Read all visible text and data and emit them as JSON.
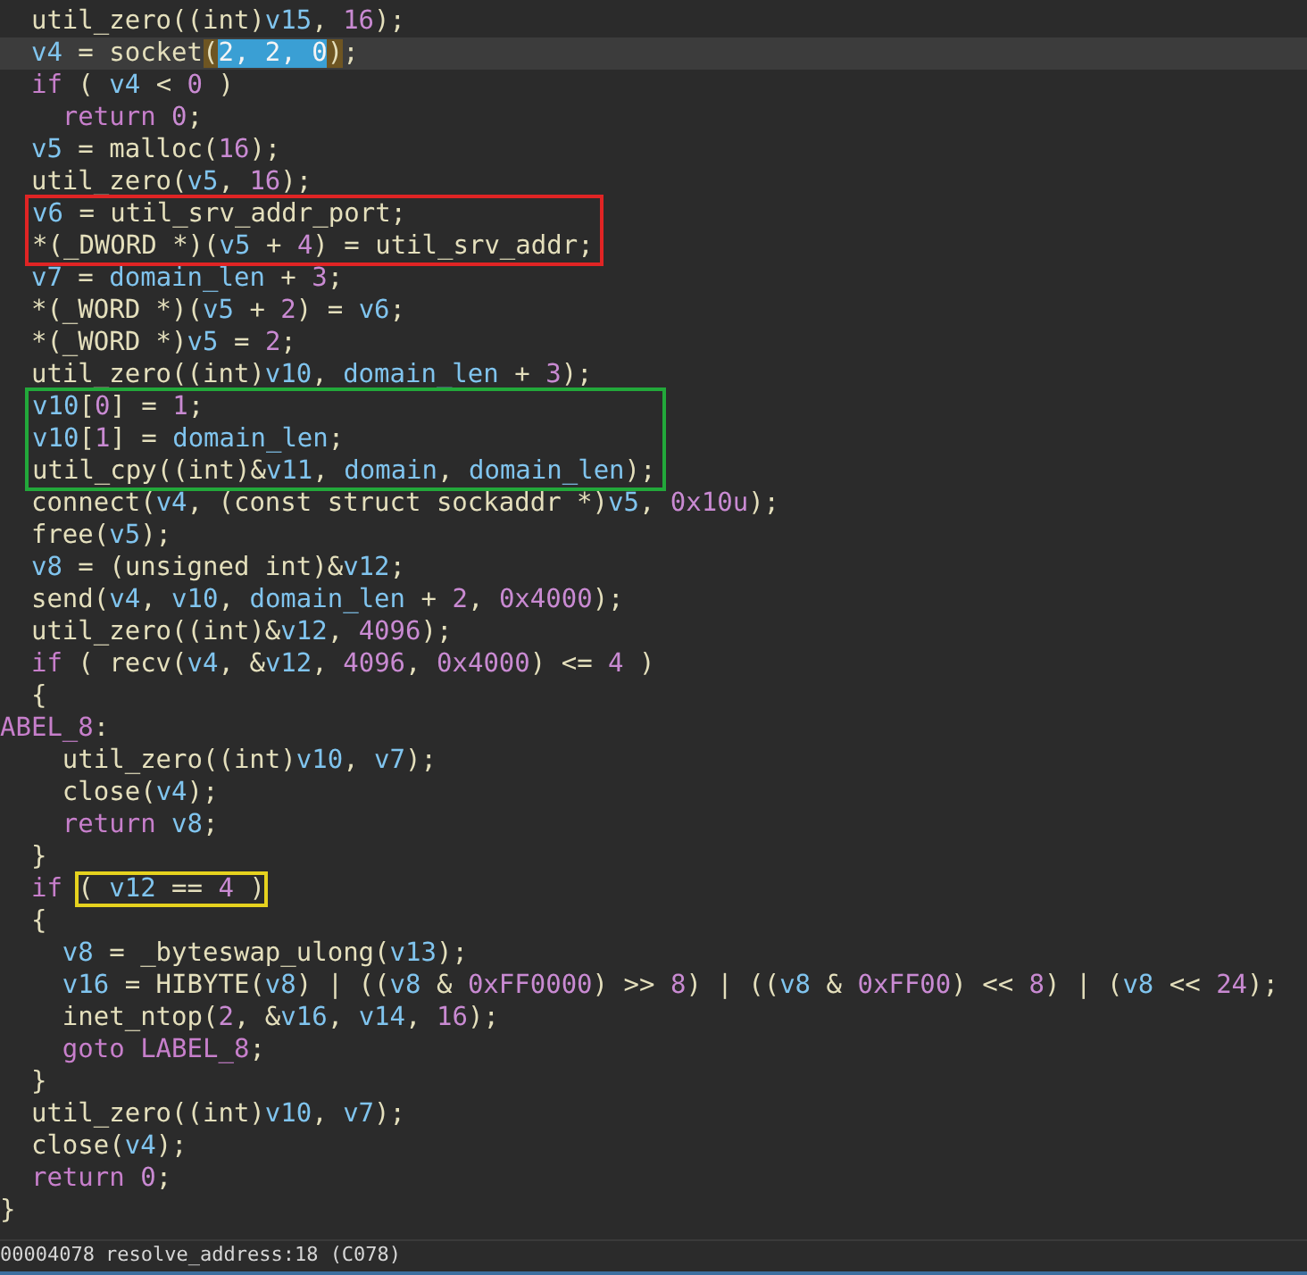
{
  "code": [
    {
      "kind": "line",
      "current": false,
      "segments": [
        {
          "kind": "p",
          "text": "  util_zero((int)"
        },
        {
          "kind": "v",
          "text": "v15"
        },
        {
          "kind": "p",
          "text": ", "
        },
        {
          "kind": "n",
          "text": "16"
        },
        {
          "kind": "p",
          "text": ");"
        }
      ]
    },
    {
      "kind": "line",
      "current": true,
      "segments": [
        {
          "kind": "v",
          "text": "  v4"
        },
        {
          "kind": "p",
          "text": " = socket"
        },
        {
          "kind": "brace",
          "text": "("
        },
        {
          "kind": "sel",
          "text": "2, 2, 0"
        },
        {
          "kind": "brace",
          "text": ")"
        },
        {
          "kind": "p",
          "text": ";"
        }
      ]
    },
    {
      "kind": "line",
      "current": false,
      "segments": [
        {
          "kind": "k",
          "text": "  if"
        },
        {
          "kind": "p",
          "text": " ( "
        },
        {
          "kind": "v",
          "text": "v4"
        },
        {
          "kind": "p",
          "text": " < "
        },
        {
          "kind": "n",
          "text": "0"
        },
        {
          "kind": "p",
          "text": " )"
        }
      ]
    },
    {
      "kind": "line",
      "current": false,
      "segments": [
        {
          "kind": "k",
          "text": "    return "
        },
        {
          "kind": "n",
          "text": "0"
        },
        {
          "kind": "p",
          "text": ";"
        }
      ]
    },
    {
      "kind": "line",
      "current": false,
      "segments": [
        {
          "kind": "v",
          "text": "  v5"
        },
        {
          "kind": "p",
          "text": " = malloc("
        },
        {
          "kind": "n",
          "text": "16"
        },
        {
          "kind": "p",
          "text": ");"
        }
      ]
    },
    {
      "kind": "line",
      "current": false,
      "segments": [
        {
          "kind": "p",
          "text": "  util_zero("
        },
        {
          "kind": "v",
          "text": "v5"
        },
        {
          "kind": "p",
          "text": ", "
        },
        {
          "kind": "n",
          "text": "16"
        },
        {
          "kind": "p",
          "text": ");"
        }
      ]
    },
    {
      "kind": "box",
      "color": "#e02424",
      "lines": [
        {
          "current": false,
          "segments": [
            {
              "kind": "v",
              "text": "v6"
            },
            {
              "kind": "p",
              "text": " = util_srv_addr_port;"
            }
          ]
        },
        {
          "current": false,
          "segments": [
            {
              "kind": "p",
              "text": "*(_DWORD *)("
            },
            {
              "kind": "v",
              "text": "v5"
            },
            {
              "kind": "p",
              "text": " + "
            },
            {
              "kind": "n",
              "text": "4"
            },
            {
              "kind": "p",
              "text": ") = util_srv_addr;"
            }
          ]
        }
      ]
    },
    {
      "kind": "line",
      "current": false,
      "segments": [
        {
          "kind": "v",
          "text": "  v7"
        },
        {
          "kind": "p",
          "text": " = "
        },
        {
          "kind": "v",
          "text": "domain_len"
        },
        {
          "kind": "p",
          "text": " + "
        },
        {
          "kind": "n",
          "text": "3"
        },
        {
          "kind": "p",
          "text": ";"
        }
      ]
    },
    {
      "kind": "line",
      "current": false,
      "segments": [
        {
          "kind": "p",
          "text": "  *(_WORD *)("
        },
        {
          "kind": "v",
          "text": "v5"
        },
        {
          "kind": "p",
          "text": " + "
        },
        {
          "kind": "n",
          "text": "2"
        },
        {
          "kind": "p",
          "text": ") = "
        },
        {
          "kind": "v",
          "text": "v6"
        },
        {
          "kind": "p",
          "text": ";"
        }
      ]
    },
    {
      "kind": "line",
      "current": false,
      "segments": [
        {
          "kind": "p",
          "text": "  *(_WORD *)"
        },
        {
          "kind": "v",
          "text": "v5"
        },
        {
          "kind": "p",
          "text": " = "
        },
        {
          "kind": "n",
          "text": "2"
        },
        {
          "kind": "p",
          "text": ";"
        }
      ]
    },
    {
      "kind": "line",
      "current": false,
      "segments": [
        {
          "kind": "p",
          "text": "  util_zero((int)"
        },
        {
          "kind": "v",
          "text": "v10"
        },
        {
          "kind": "p",
          "text": ", "
        },
        {
          "kind": "v",
          "text": "domain_len"
        },
        {
          "kind": "p",
          "text": " + "
        },
        {
          "kind": "n",
          "text": "3"
        },
        {
          "kind": "p",
          "text": ");"
        }
      ]
    },
    {
      "kind": "box",
      "color": "#22a83a",
      "lines": [
        {
          "current": false,
          "segments": [
            {
              "kind": "v",
              "text": "v10"
            },
            {
              "kind": "p",
              "text": "["
            },
            {
              "kind": "n",
              "text": "0"
            },
            {
              "kind": "p",
              "text": "] = "
            },
            {
              "kind": "n",
              "text": "1"
            },
            {
              "kind": "p",
              "text": ";"
            }
          ]
        },
        {
          "current": false,
          "segments": [
            {
              "kind": "v",
              "text": "v10"
            },
            {
              "kind": "p",
              "text": "["
            },
            {
              "kind": "n",
              "text": "1"
            },
            {
              "kind": "p",
              "text": "] = "
            },
            {
              "kind": "v",
              "text": "domain_len"
            },
            {
              "kind": "p",
              "text": ";"
            }
          ]
        },
        {
          "current": false,
          "segments": [
            {
              "kind": "p",
              "text": "util_cpy((int)&"
            },
            {
              "kind": "v",
              "text": "v11"
            },
            {
              "kind": "p",
              "text": ", "
            },
            {
              "kind": "v",
              "text": "domain"
            },
            {
              "kind": "p",
              "text": ", "
            },
            {
              "kind": "v",
              "text": "domain_len"
            },
            {
              "kind": "p",
              "text": ");"
            }
          ]
        }
      ]
    },
    {
      "kind": "line",
      "current": false,
      "segments": [
        {
          "kind": "p",
          "text": "  connect("
        },
        {
          "kind": "v",
          "text": "v4"
        },
        {
          "kind": "p",
          "text": ", (const struct sockaddr *)"
        },
        {
          "kind": "v",
          "text": "v5"
        },
        {
          "kind": "p",
          "text": ", "
        },
        {
          "kind": "n",
          "text": "0x10u"
        },
        {
          "kind": "p",
          "text": ");"
        }
      ]
    },
    {
      "kind": "line",
      "current": false,
      "segments": [
        {
          "kind": "p",
          "text": "  free("
        },
        {
          "kind": "v",
          "text": "v5"
        },
        {
          "kind": "p",
          "text": ");"
        }
      ]
    },
    {
      "kind": "line",
      "current": false,
      "segments": [
        {
          "kind": "v",
          "text": "  v8"
        },
        {
          "kind": "p",
          "text": " = (unsigned int)&"
        },
        {
          "kind": "v",
          "text": "v12"
        },
        {
          "kind": "p",
          "text": ";"
        }
      ]
    },
    {
      "kind": "line",
      "current": false,
      "segments": [
        {
          "kind": "p",
          "text": "  send("
        },
        {
          "kind": "v",
          "text": "v4"
        },
        {
          "kind": "p",
          "text": ", "
        },
        {
          "kind": "v",
          "text": "v10"
        },
        {
          "kind": "p",
          "text": ", "
        },
        {
          "kind": "v",
          "text": "domain_len"
        },
        {
          "kind": "p",
          "text": " + "
        },
        {
          "kind": "n",
          "text": "2"
        },
        {
          "kind": "p",
          "text": ", "
        },
        {
          "kind": "n",
          "text": "0x4000"
        },
        {
          "kind": "p",
          "text": ");"
        }
      ]
    },
    {
      "kind": "line",
      "current": false,
      "segments": [
        {
          "kind": "p",
          "text": "  util_zero((int)&"
        },
        {
          "kind": "v",
          "text": "v12"
        },
        {
          "kind": "p",
          "text": ", "
        },
        {
          "kind": "n",
          "text": "4096"
        },
        {
          "kind": "p",
          "text": ");"
        }
      ]
    },
    {
      "kind": "line",
      "current": false,
      "segments": [
        {
          "kind": "k",
          "text": "  if"
        },
        {
          "kind": "p",
          "text": " ( recv("
        },
        {
          "kind": "v",
          "text": "v4"
        },
        {
          "kind": "p",
          "text": ", &"
        },
        {
          "kind": "v",
          "text": "v12"
        },
        {
          "kind": "p",
          "text": ", "
        },
        {
          "kind": "n",
          "text": "4096"
        },
        {
          "kind": "p",
          "text": ", "
        },
        {
          "kind": "n",
          "text": "0x4000"
        },
        {
          "kind": "p",
          "text": ") <= "
        },
        {
          "kind": "n",
          "text": "4"
        },
        {
          "kind": "p",
          "text": " )"
        }
      ]
    },
    {
      "kind": "line",
      "current": false,
      "segments": [
        {
          "kind": "p",
          "text": "  {"
        }
      ]
    },
    {
      "kind": "line",
      "current": false,
      "segments": [
        {
          "kind": "l",
          "text": "ABEL_8"
        },
        {
          "kind": "p",
          "text": ":"
        }
      ]
    },
    {
      "kind": "line",
      "current": false,
      "segments": [
        {
          "kind": "p",
          "text": "    util_zero((int)"
        },
        {
          "kind": "v",
          "text": "v10"
        },
        {
          "kind": "p",
          "text": ", "
        },
        {
          "kind": "v",
          "text": "v7"
        },
        {
          "kind": "p",
          "text": ");"
        }
      ]
    },
    {
      "kind": "line",
      "current": false,
      "segments": [
        {
          "kind": "p",
          "text": "    close("
        },
        {
          "kind": "v",
          "text": "v4"
        },
        {
          "kind": "p",
          "text": ");"
        }
      ]
    },
    {
      "kind": "line",
      "current": false,
      "segments": [
        {
          "kind": "k",
          "text": "    return "
        },
        {
          "kind": "v",
          "text": "v8"
        },
        {
          "kind": "p",
          "text": ";"
        }
      ]
    },
    {
      "kind": "line",
      "current": false,
      "segments": [
        {
          "kind": "p",
          "text": "  }"
        }
      ]
    },
    {
      "kind": "line",
      "current": false,
      "segments": [
        {
          "kind": "k",
          "text": "  if "
        },
        {
          "kind": "box",
          "color": "#e6d21e",
          "segments": [
            {
              "kind": "p",
              "text": "( "
            },
            {
              "kind": "v",
              "text": "v12"
            },
            {
              "kind": "p",
              "text": " == "
            },
            {
              "kind": "n",
              "text": "4"
            },
            {
              "kind": "p",
              "text": " )"
            }
          ]
        }
      ]
    },
    {
      "kind": "line",
      "current": false,
      "segments": [
        {
          "kind": "p",
          "text": "  {"
        }
      ]
    },
    {
      "kind": "line",
      "current": false,
      "segments": [
        {
          "kind": "v",
          "text": "    v8"
        },
        {
          "kind": "p",
          "text": " = _byteswap_ulong("
        },
        {
          "kind": "v",
          "text": "v13"
        },
        {
          "kind": "p",
          "text": ");"
        }
      ]
    },
    {
      "kind": "line",
      "current": false,
      "segments": [
        {
          "kind": "v",
          "text": "    v16"
        },
        {
          "kind": "p",
          "text": " = HIBYTE("
        },
        {
          "kind": "v",
          "text": "v8"
        },
        {
          "kind": "p",
          "text": ") | (("
        },
        {
          "kind": "v",
          "text": "v8"
        },
        {
          "kind": "p",
          "text": " & "
        },
        {
          "kind": "n",
          "text": "0xFF0000"
        },
        {
          "kind": "p",
          "text": ") >> "
        },
        {
          "kind": "n",
          "text": "8"
        },
        {
          "kind": "p",
          "text": ") | (("
        },
        {
          "kind": "v",
          "text": "v8"
        },
        {
          "kind": "p",
          "text": " & "
        },
        {
          "kind": "n",
          "text": "0xFF00"
        },
        {
          "kind": "p",
          "text": ") << "
        },
        {
          "kind": "n",
          "text": "8"
        },
        {
          "kind": "p",
          "text": ") | ("
        },
        {
          "kind": "v",
          "text": "v8"
        },
        {
          "kind": "p",
          "text": " << "
        },
        {
          "kind": "n",
          "text": "24"
        },
        {
          "kind": "p",
          "text": ");"
        }
      ]
    },
    {
      "kind": "line",
      "current": false,
      "segments": [
        {
          "kind": "p",
          "text": "    inet_ntop("
        },
        {
          "kind": "n",
          "text": "2"
        },
        {
          "kind": "p",
          "text": ", &"
        },
        {
          "kind": "v",
          "text": "v16"
        },
        {
          "kind": "p",
          "text": ", "
        },
        {
          "kind": "v",
          "text": "v14"
        },
        {
          "kind": "p",
          "text": ", "
        },
        {
          "kind": "n",
          "text": "16"
        },
        {
          "kind": "p",
          "text": ");"
        }
      ]
    },
    {
      "kind": "line",
      "current": false,
      "segments": [
        {
          "kind": "k",
          "text": "    goto "
        },
        {
          "kind": "l",
          "text": "LABEL_8"
        },
        {
          "kind": "p",
          "text": ";"
        }
      ]
    },
    {
      "kind": "line",
      "current": false,
      "segments": [
        {
          "kind": "p",
          "text": "  }"
        }
      ]
    },
    {
      "kind": "line",
      "current": false,
      "segments": [
        {
          "kind": "p",
          "text": "  util_zero((int)"
        },
        {
          "kind": "v",
          "text": "v10"
        },
        {
          "kind": "p",
          "text": ", "
        },
        {
          "kind": "v",
          "text": "v7"
        },
        {
          "kind": "p",
          "text": ");"
        }
      ]
    },
    {
      "kind": "line",
      "current": false,
      "segments": [
        {
          "kind": "p",
          "text": "  close("
        },
        {
          "kind": "v",
          "text": "v4"
        },
        {
          "kind": "p",
          "text": ");"
        }
      ]
    },
    {
      "kind": "line",
      "current": false,
      "segments": [
        {
          "kind": "k",
          "text": "  return "
        },
        {
          "kind": "n",
          "text": "0"
        },
        {
          "kind": "p",
          "text": ";"
        }
      ]
    },
    {
      "kind": "line",
      "current": false,
      "segments": [
        {
          "kind": "p",
          "text": "}"
        }
      ]
    }
  ],
  "status_bar": {
    "address": "00004078",
    "location": "resolve_address:18 (C078)"
  }
}
